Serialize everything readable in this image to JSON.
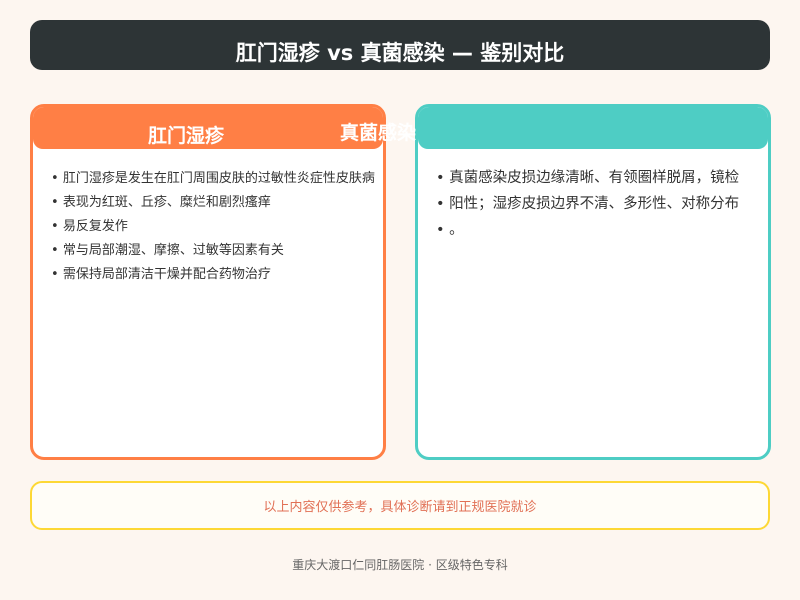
{
  "title": "肛门湿疹 vs 真菌感染 — 鉴别对比",
  "left_card": {
    "header": "肛门湿疹",
    "items": [
      "肛门湿疹是发生在肛门周围皮肤的过敏性炎症性皮肤病",
      "表现为红斑、丘疹、糜烂和剧烈瘙痒",
      "易反复发作",
      "常与局部潮湿、摩擦、过敏等因素有关",
      "需保持局部清洁干燥并配合药物治疗"
    ]
  },
  "right_card": {
    "header": "真菌感染",
    "items": [
      "真菌感染皮损边缘清晰、有领圈样脱屑，镜检",
      "阳性；湿疹皮损边界不清、多形性、对称分布",
      "。"
    ]
  },
  "notice": "以上内容仅供参考，具体诊断请到正规医院就诊",
  "footer": "重庆大渡口仁同肛肠医院 · 区级特色专科",
  "colors": {
    "title_bg": "#2d3436",
    "left_accent": "#ff7f45",
    "right_accent": "#4ecdc4",
    "notice_border": "#fdd835",
    "notice_text": "#e17055"
  }
}
